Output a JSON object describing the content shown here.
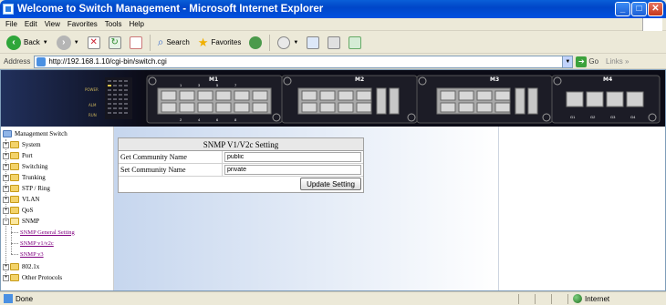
{
  "window": {
    "title": "Welcome to Switch Management - Microsoft Internet Explorer"
  },
  "menu": [
    "File",
    "Edit",
    "View",
    "Favorites",
    "Tools",
    "Help"
  ],
  "toolbar": {
    "back": "Back",
    "search": "Search",
    "favorites": "Favorites"
  },
  "address": {
    "label": "Address",
    "url": "http://192.168.1.10/cgi-bin/switch.cgi",
    "go": "Go",
    "links": "Links"
  },
  "banner": {
    "modules": [
      "M1",
      "M2",
      "M3",
      "M4"
    ],
    "port_numbers_top": [
      "1",
      "3",
      "5",
      "7"
    ],
    "port_numbers_bottom": [
      "2",
      "4",
      "6",
      "8"
    ],
    "m4_ports": [
      "G1",
      "G2",
      "G3",
      "G4"
    ],
    "led_labels": [
      "POWER",
      "ALM",
      "RUN"
    ]
  },
  "tree": {
    "root": "Management Switch",
    "items": [
      "System",
      "Port",
      "Switching",
      "Trunking",
      "STP / Ring",
      "VLAN",
      "QoS",
      "SNMP"
    ],
    "snmp_children": [
      "SNMP General Setting",
      "SNMP v1/v2c",
      "SNMP v3"
    ],
    "items_after": [
      "802.1x",
      "Other Protocols"
    ]
  },
  "snmp": {
    "title": "SNMP V1/V2c Setting",
    "get_label": "Get Community Name",
    "get_value": "public",
    "set_label": "Set Community Name",
    "set_value": "private",
    "button": "Update Setting"
  },
  "status": {
    "left": "Done",
    "zone": "Internet"
  }
}
